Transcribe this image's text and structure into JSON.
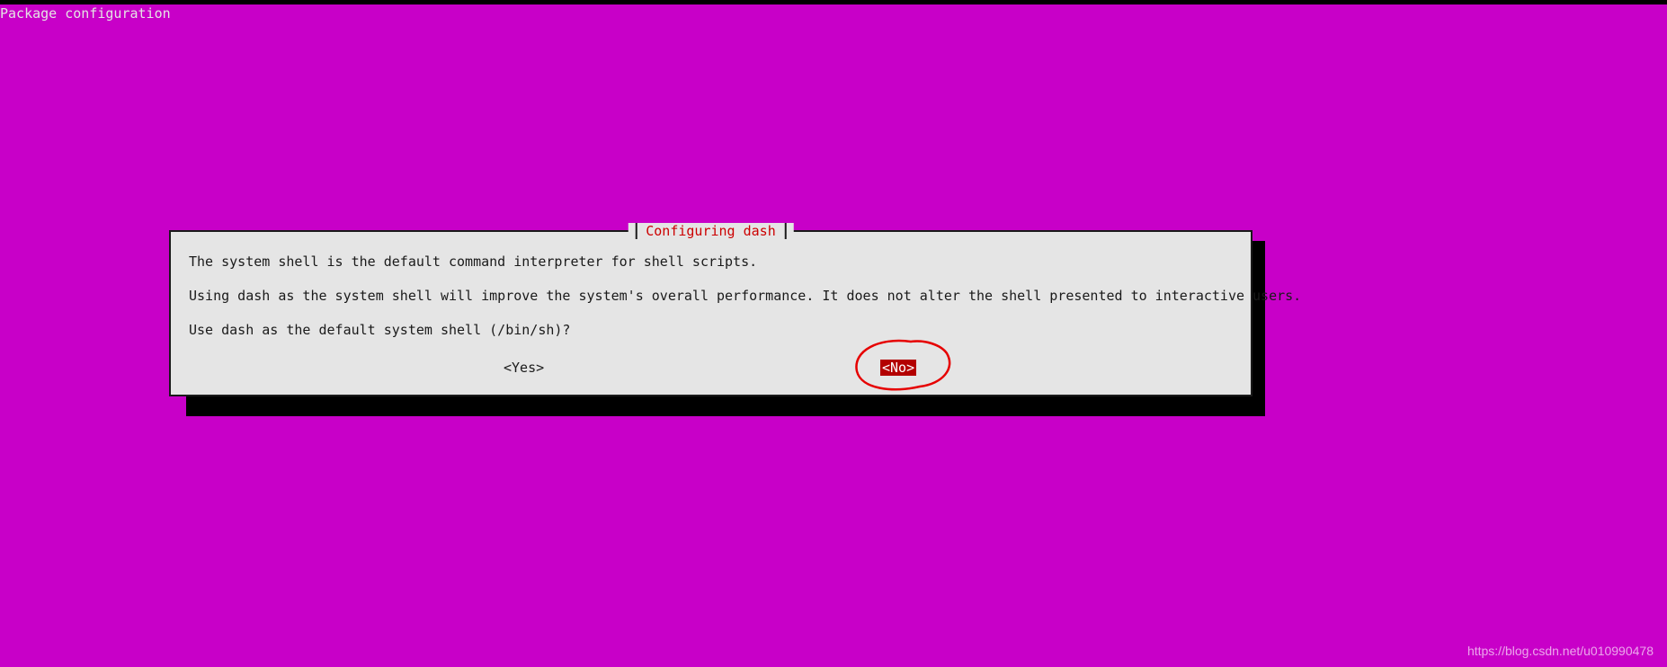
{
  "header": {
    "title": "Package configuration"
  },
  "dialog": {
    "title": "Configuring dash",
    "paragraphs": [
      "The system shell is the default command interpreter for shell scripts.",
      "Using dash as the system shell will improve the system's overall performance. It does not alter the shell presented to interactive users.",
      "Use dash as the default system shell (/bin/sh)?"
    ],
    "buttons": {
      "yes": "<Yes>",
      "no": "<No>"
    },
    "selected": "no"
  },
  "watermark": "https://blog.csdn.net/u010990478"
}
